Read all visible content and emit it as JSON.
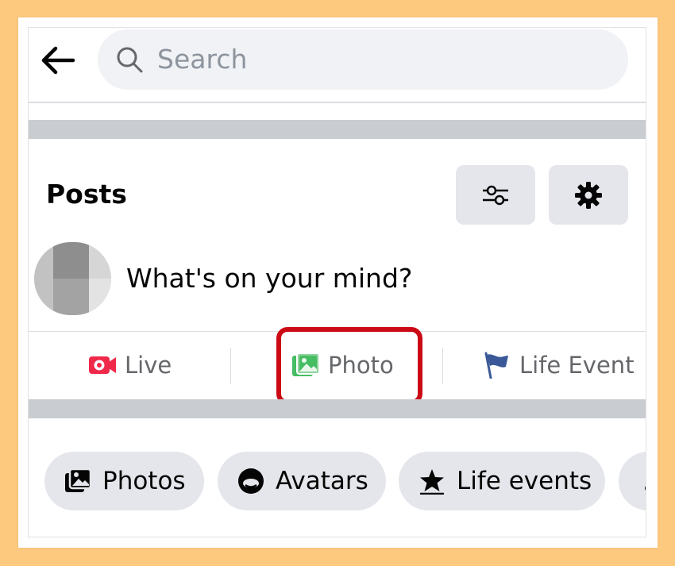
{
  "search": {
    "placeholder": "Search"
  },
  "posts": {
    "title": "Posts",
    "composer_prompt": "What's on your mind?"
  },
  "actions": [
    {
      "label": "Live",
      "icon": "live-video-icon",
      "color": "#f02849"
    },
    {
      "label": "Photo",
      "icon": "photo-icon",
      "color": "#45bd62"
    },
    {
      "label": "Life Event",
      "icon": "flag-icon",
      "color": "#3b5998"
    }
  ],
  "filters": [
    {
      "label": "Photos",
      "icon": "photos-icon"
    },
    {
      "label": "Avatars",
      "icon": "avatar-face-icon"
    },
    {
      "label": "Life events",
      "icon": "star-icon"
    },
    {
      "label": "",
      "icon": "music-note-icon"
    }
  ],
  "colors": {
    "background": "#fdc97e",
    "highlight_border": "#cc0a16",
    "chip_bg": "#e4e6eb",
    "secondary_text": "#65676b"
  }
}
